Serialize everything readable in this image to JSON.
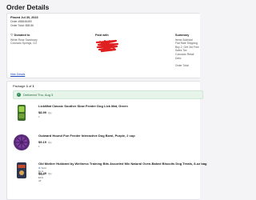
{
  "page": {
    "title": "Order Details"
  },
  "order": {
    "placed": "Placed Jul 30, 2023",
    "number": "Order #58848489",
    "total": "Order Total: $58.86"
  },
  "donated": {
    "heading": "Donated to",
    "line1": "White Rose Sanctuary",
    "line2": "Colorado Springs, CO"
  },
  "paid": {
    "heading": "Paid with"
  },
  "summary": {
    "heading": "Summary",
    "lines": [
      "Items Subtotal",
      "Flat Rate Shipping",
      "Buy 2, Get 3rd Free",
      "Sales Tax",
      "Colorado Retail Deliv",
      "",
      "Order Total"
    ]
  },
  "hide_details": "Hide Details",
  "package": {
    "prefix": "Package",
    "number": "1",
    "of": "of",
    "total": "1",
    "delivered": "Delivered Thu, Aug 3"
  },
  "items": [
    {
      "name": "LickiMat Classic Soother Slow Feeder Dog Lick Mat, Green",
      "price": "$8.99",
      "qty": "Qty 1",
      "seller": ""
    },
    {
      "name": "Outward Hound Fun Feeder Interactive Dog Bowl, Purple, 2 cup",
      "price": "$9.19",
      "qty": "Qty 1",
      "seller": ""
    },
    {
      "name": "Old Mother Hubbard by Wellness Training Bits Assorted Mix Natural Oven-Baked Biscuits Dog Treats, 8-oz bag",
      "price": "$4.49",
      "qty": "Qty 1",
      "seller": "Sold by & Ships: 10% off"
    }
  ],
  "colors": {
    "accent": "#1c49c2",
    "delivered_bg": "#e6f4ea",
    "delivered_text": "#1f6b3a",
    "redaction": "#e02020"
  }
}
